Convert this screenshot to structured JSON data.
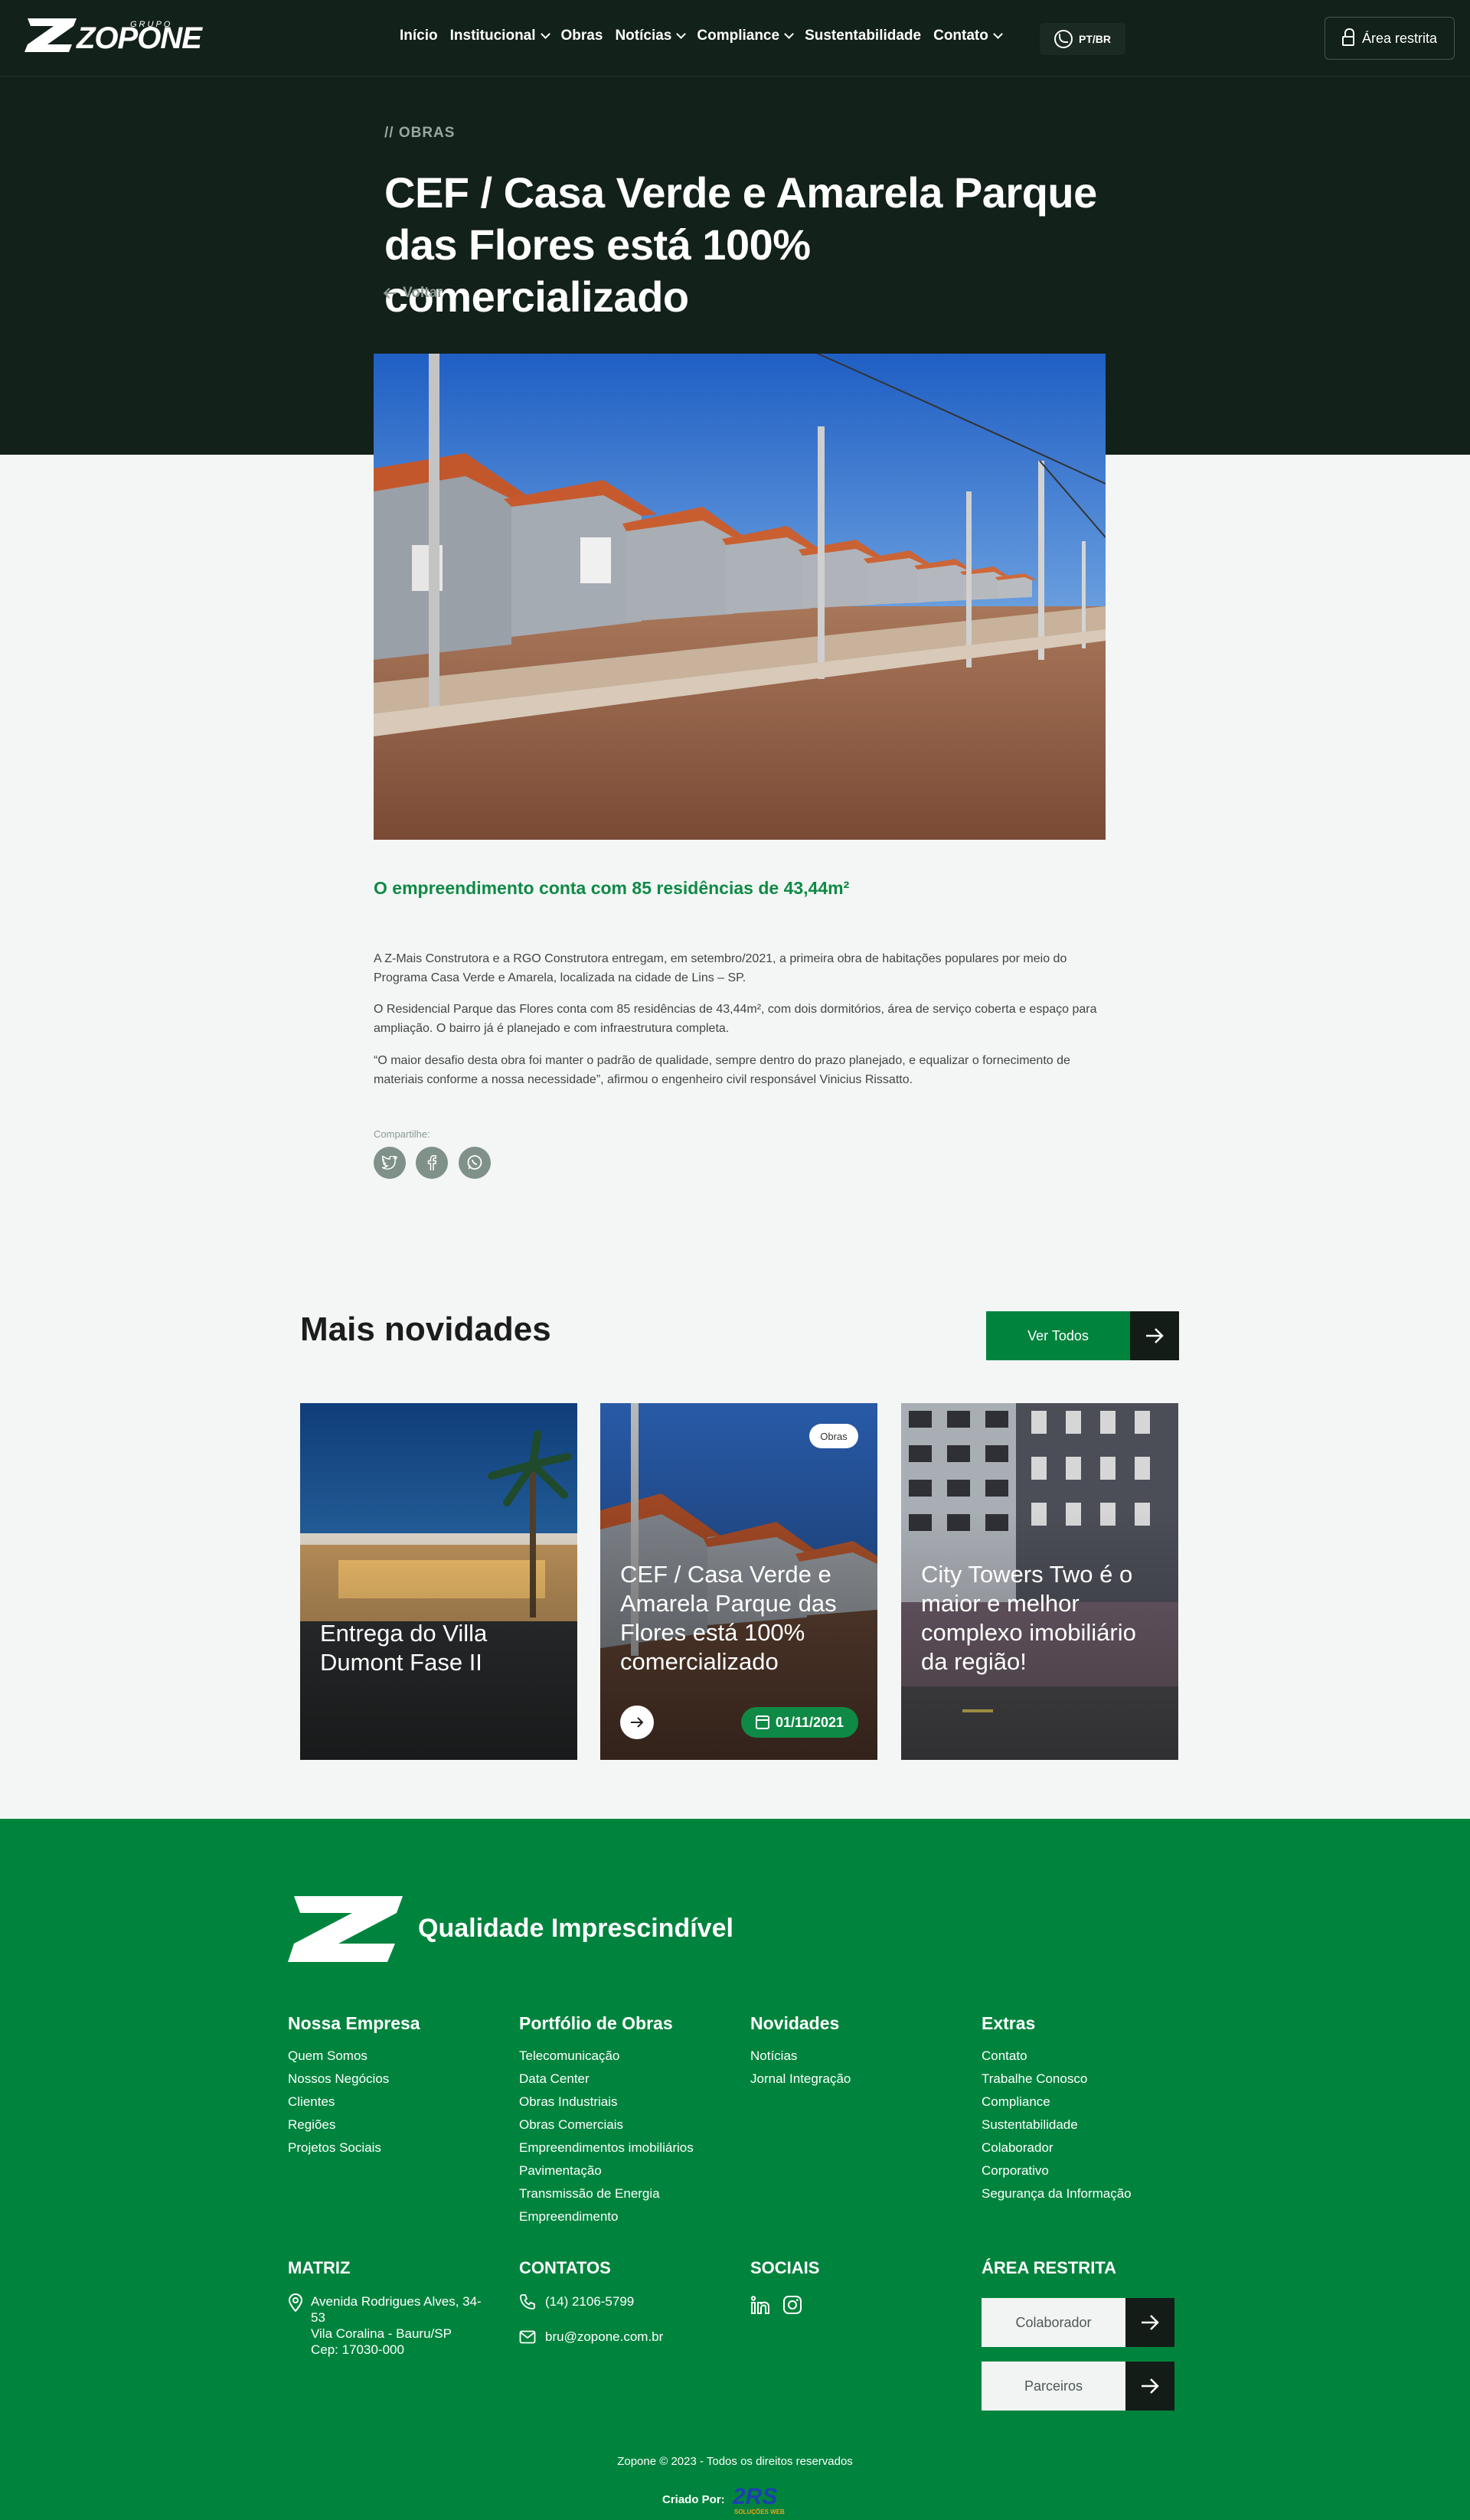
{
  "header": {
    "logo_small": "GRUPO",
    "logo_word": "ZOPONE",
    "nav": [
      {
        "label": "Início",
        "dropdown": false
      },
      {
        "label": "Institucional",
        "dropdown": true
      },
      {
        "label": "Obras",
        "dropdown": false
      },
      {
        "label": "Notícias",
        "dropdown": true
      },
      {
        "label": "Compliance",
        "dropdown": true
      },
      {
        "label": "Sustentabilidade",
        "dropdown": false
      },
      {
        "label": "Contato",
        "dropdown": true
      }
    ],
    "language": "PT/BR",
    "restricted_area": "Área restrita"
  },
  "hero": {
    "breadcrumb": "// OBRAS",
    "title": "CEF / Casa Verde e Amarela Parque das Flores está 100% comercializado",
    "back": "Voltar"
  },
  "article": {
    "lead": "O empreendimento conta com 85 residências de 43,44m²",
    "paragraphs": [
      "A Z-Mais Construtora e a RGO Construtora entregam, em setembro/2021, a primeira obra de habitações populares por meio do Programa Casa Verde e Amarela, localizada na cidade de Lins – SP.",
      "O Residencial Parque das Flores conta com 85 residências de 43,44m², com dois dormitórios, área de serviço coberta e espaço para ampliação. O bairro já é planejado e com infraestrutura completa.",
      "“O maior desafio desta obra foi manter o padrão de qualidade, sempre dentro do prazo planejado, e equalizar o fornecimento de materiais conforme a nossa necessidade”, afirmou o engenheiro civil responsável Vinicius Rissatto."
    ],
    "share_label": "Compartilhe:",
    "share_icons": [
      "twitter-icon",
      "facebook-icon",
      "whatsapp-icon"
    ]
  },
  "more_news": {
    "title": "Mais novidades",
    "see_all": "Ver Todos",
    "cards": [
      {
        "title": "Entrega do Villa Dumont Fase II"
      },
      {
        "title": "CEF / Casa Verde e Amarela Parque das Flores está 100% comercializado",
        "tag": "Obras",
        "date": "01/11/2021"
      },
      {
        "title": "City Towers Two é o maior e melhor complexo imobiliário da região!"
      }
    ]
  },
  "footer": {
    "tagline": "Qualidade Imprescindível",
    "columns": [
      {
        "title": "Nossa Empresa",
        "links": [
          "Quem Somos",
          "Nossos Negócios",
          "Clientes",
          "Regiões",
          "Projetos Sociais"
        ]
      },
      {
        "title": "Portfólio de Obras",
        "links": [
          "Telecomunicação",
          "Data Center",
          "Obras Industriais",
          "Obras Comerciais",
          "Empreendimentos imobiliários",
          "Pavimentação",
          "Transmissão de Energia",
          "Empreendimento"
        ]
      },
      {
        "title": "Novidades",
        "links": [
          "Notícias",
          "Jornal Integração"
        ]
      },
      {
        "title": "Extras",
        "links": [
          "Contato",
          "Trabalhe Conosco",
          "Compliance",
          "Sustentabilidade",
          "Colaborador",
          "Corporativo",
          "Segurança da Informação"
        ]
      }
    ],
    "matriz_title": "MATRIZ",
    "address": [
      "Avenida Rodrigues Alves, 34-53",
      "Vila Coralina - Bauru/SP",
      "Cep: 17030-000"
    ],
    "contacts_title": "CONTATOS",
    "phone": "(14) 2106-5799",
    "email": "bru@zopone.com.br",
    "social_title": "SOCIAIS",
    "restricted_title": "ÁREA RESTRITA",
    "collaborator": "Colaborador",
    "partners": "Parceiros",
    "copyright": "Zopone © 2023 - Todos os direitos reservados",
    "created_by": "Criado Por:",
    "agency_logo_text": "2RS",
    "agency_sub": "SOLUÇÕES WEB"
  },
  "colors": {
    "dark": "#122119",
    "brand_green": "#00843d",
    "accent_green": "#0f8a46",
    "page_bg": "#f3f6f5"
  }
}
